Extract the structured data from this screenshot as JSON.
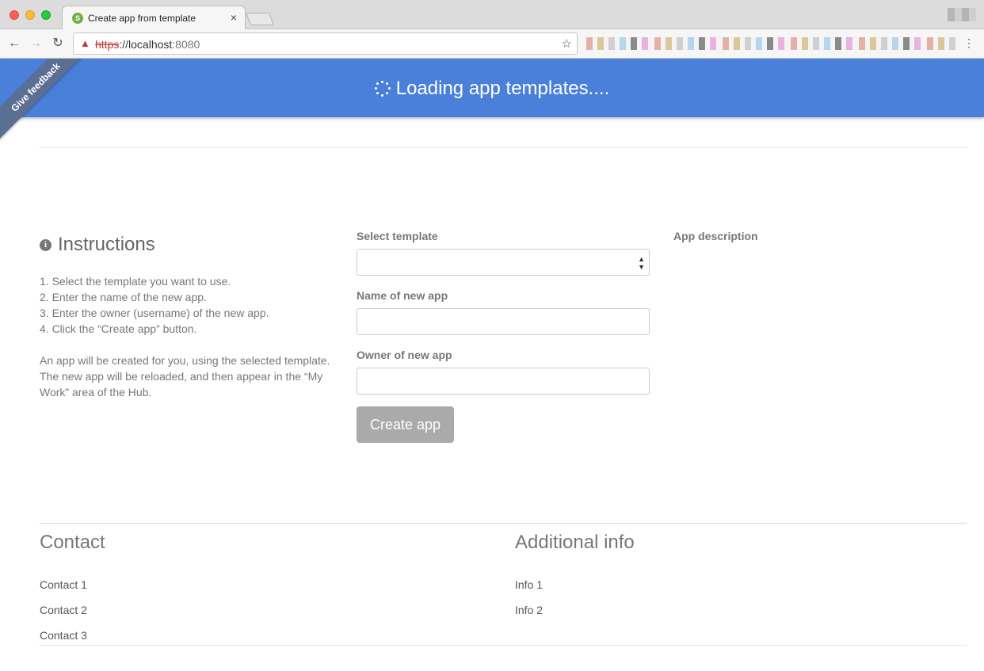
{
  "browser": {
    "tab_title": "Create app from template",
    "tab_favicon": "S",
    "tab_close": "×",
    "url_scheme": "https",
    "url_sep": "://",
    "url_host": "localhost",
    "url_port": ":8080"
  },
  "banner": {
    "text": "Loading app templates...."
  },
  "feedback": {
    "label": "Give feedback"
  },
  "instructions": {
    "title": "Instructions",
    "steps": [
      "1. Select the template you want to use.",
      "2. Enter the name of the new app.",
      "3. Enter the owner (username) of the new app.",
      "4. Click the “Create app” button."
    ],
    "paragraph": "An app will be created for you, using the selected template. The new app will be reloaded, and then appear in the “My Work” area of the Hub."
  },
  "form": {
    "template_label": "Select template",
    "template_value": "",
    "name_label": "Name of new app",
    "name_value": "",
    "owner_label": "Owner of new app",
    "owner_value": "",
    "create_button": "Create app"
  },
  "description": {
    "label": "App description"
  },
  "footer": {
    "contact_title": "Contact",
    "contacts": [
      "Contact 1",
      "Contact 2",
      "Contact 3"
    ],
    "info_title": "Additional info",
    "infos": [
      "Info 1",
      "Info 2"
    ]
  },
  "colors": {
    "banner": "#4a80d9",
    "button_disabled": "#aaaaaa"
  }
}
